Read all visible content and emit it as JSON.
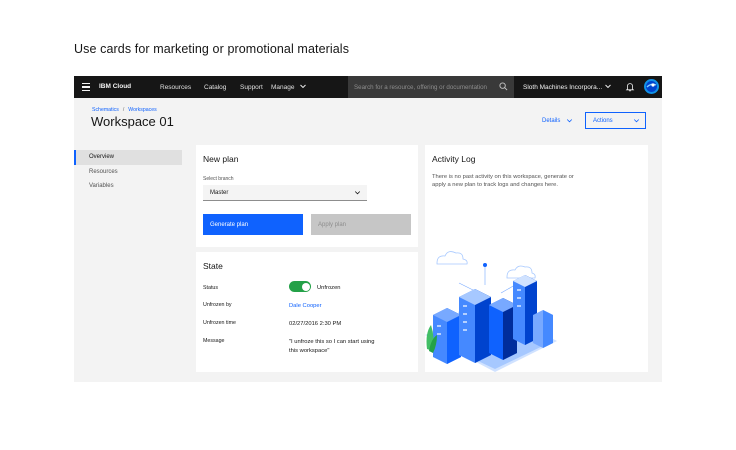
{
  "caption": "Use cards for marketing or promotional materials",
  "topbar": {
    "brand": "IBM Cloud",
    "nav": [
      "Resources",
      "Catalog",
      "Support",
      "Manage"
    ],
    "search_placeholder": "Search for a resource, offering or documentation",
    "account": "Sloth Machines Incorpora..."
  },
  "breadcrumb": [
    "Schematics",
    "Workspaces"
  ],
  "page_title": "Workspace 01",
  "header_actions": {
    "details": "Details",
    "actions": "Actions"
  },
  "sidebar": {
    "items": [
      "Overview",
      "Resources",
      "Variables"
    ],
    "active": "Overview"
  },
  "new_plan": {
    "title": "New plan",
    "branch_label": "Select branch",
    "branch_value": "Master",
    "generate": "Generate plan",
    "apply": "Apply plan"
  },
  "state": {
    "title": "State",
    "status_label": "Status",
    "status_value": "Unfrozen",
    "unfrozen_by_label": "Unfrozen by",
    "unfrozen_by_value": "Dale Cooper",
    "unfrozen_time_label": "Unfrozen time",
    "unfrozen_time_value": "02/27/2016 2:30 PM",
    "message_label": "Message",
    "message_value": "\"I unfroze this so I can start using this workspace\""
  },
  "activity": {
    "title": "Activity Log",
    "text": "There is no past activity on this workspace, generate or apply a new plan to track logs and changes here."
  },
  "colors": {
    "primary": "#0f62fe",
    "topbar": "#161616",
    "toggle_on": "#24a148"
  }
}
